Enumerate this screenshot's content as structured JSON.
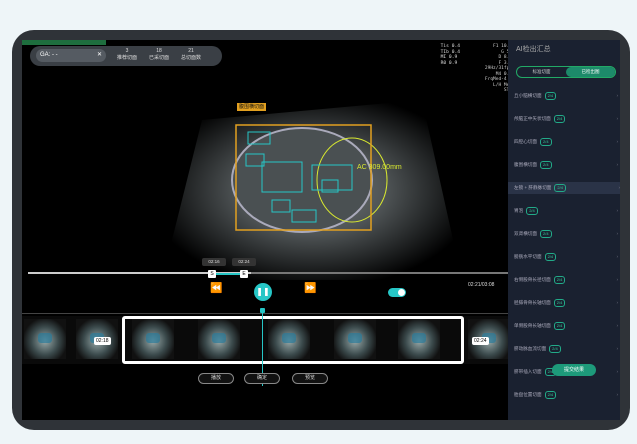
{
  "topbar": {
    "ga_label": "GA: - -",
    "stats": [
      {
        "value": "3",
        "label": "推荐切面"
      },
      {
        "value": "18",
        "label": "已采切面"
      },
      {
        "value": "21",
        "label": "总切面数"
      }
    ]
  },
  "info_left": [
    "Tis 0.4",
    "TIb 0.4",
    "MI 0.9",
    "R0 0.9"
  ],
  "info_right": [
    "F1 10.0",
    "G 50",
    "D 8.9",
    "F 3.0",
    "29Hz/31fps",
    "M4 0.9",
    "FrqMed-4 L",
    "L/H Med",
    "STC"
  ],
  "image": {
    "tag_label": "腹围横切面",
    "ac_label": "AC 309.00mm"
  },
  "playback": {
    "marker_a": "02:16",
    "marker_b": "02:24",
    "mark_a_label": "S",
    "mark_b_label": "E",
    "time_readout": "02:21/03:08",
    "progress": 0.46
  },
  "filmstrip": {
    "start_label": "02:18",
    "end_label": "02:24"
  },
  "actions": [
    {
      "label": "播放"
    },
    {
      "label": "确定"
    },
    {
      "label": "预览"
    }
  ],
  "sidebar": {
    "title": "AI检出汇总",
    "seg_left": "标准切面",
    "seg_right": "已检出图",
    "items": [
      {
        "label": "丘小脑横切面",
        "count": "2/4"
      },
      {
        "label": "颅脑正中矢状切面",
        "count": "2/4"
      },
      {
        "label": "四腔心切面",
        "count": "2/4"
      },
      {
        "label": "腹围横切面",
        "count": "2/4"
      },
      {
        "label": "左锁 + 肝静脉切面",
        "count": "2/4"
      },
      {
        "label": "胃泡",
        "count": "2/4"
      },
      {
        "label": "双肾横切面",
        "count": "2/4"
      },
      {
        "label": "膀胱水平切面",
        "count": "2/4"
      },
      {
        "label": "右侧股骨长径切面",
        "count": "2/4"
      },
      {
        "label": "胫腓骨骨长轴切面",
        "count": "2/4"
      },
      {
        "label": "单侧股骨长轴切面",
        "count": "2/4"
      },
      {
        "label": "脐动脉血流切面",
        "count": "2/4"
      },
      {
        "label": "脐带插入切面",
        "count": "2/4"
      },
      {
        "label": "胎盘位置切面",
        "count": "2/4"
      }
    ],
    "active_index": 4,
    "submit_label": "提交结果"
  }
}
